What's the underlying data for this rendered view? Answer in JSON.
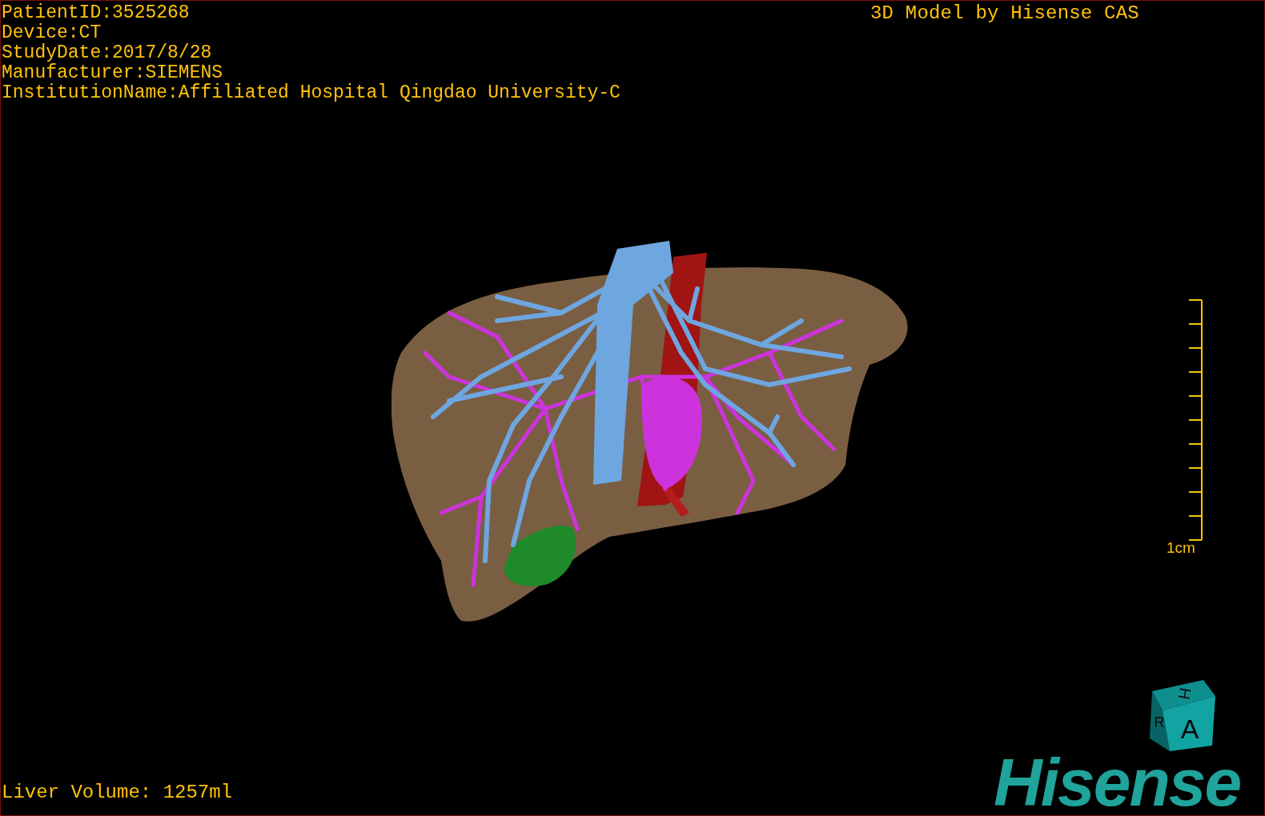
{
  "patient_info": [
    "PatientID:3525268",
    "Device:CT",
    "StudyDate:2017/8/28",
    "Manufacturer:SIEMENS",
    "InstitutionName:Affiliated Hospital Qingdao University-C"
  ],
  "model_credit": "3D Model by Hisense CAS",
  "scale_bar": {
    "label": "1cm"
  },
  "orientation_cube": {
    "top": "H",
    "side": "R",
    "front": "A"
  },
  "logo": "Hisense",
  "liver_volume": "Liver Volume: 1257ml"
}
